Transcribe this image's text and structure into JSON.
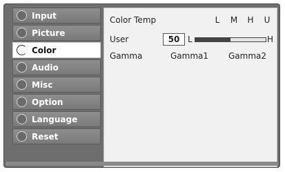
{
  "menu": [
    {
      "label": "Input",
      "active": false
    },
    {
      "label": "Picture",
      "active": false
    },
    {
      "label": "Color",
      "active": true
    },
    {
      "label": "Audio",
      "active": false
    },
    {
      "label": "Misc",
      "active": false
    },
    {
      "label": "Option",
      "active": false
    },
    {
      "label": "Language",
      "active": false
    },
    {
      "label": "Reset",
      "active": false
    }
  ],
  "color_temp": {
    "label": "Color Temp",
    "options": [
      "L",
      "M",
      "H",
      "U"
    ]
  },
  "user": {
    "label": "User",
    "value": "50",
    "min_label": "L",
    "max_label": "H",
    "level": 0.5
  },
  "gamma": {
    "label": "Gamma",
    "options": [
      "Gamma1",
      "Gamma2"
    ]
  }
}
